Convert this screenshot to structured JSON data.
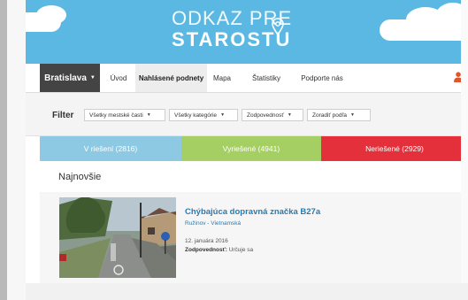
{
  "banner": {
    "logo_line1": "ODKAZ PRE",
    "logo_line2": "STAROSTU"
  },
  "nav": {
    "city": "Bratislava",
    "items": [
      {
        "label": "Úvod",
        "active": false
      },
      {
        "label": "Nahlásené podnety",
        "active": true
      },
      {
        "label": "Mapa",
        "active": false
      },
      {
        "label": "Štatistiky",
        "active": false
      },
      {
        "label": "Podporte nás",
        "active": false
      }
    ]
  },
  "filter": {
    "label": "Filter",
    "dropdowns": [
      "Všetky mestské časti",
      "Všetky kategórie",
      "Zodpovednosť",
      "Zoradiť podľa"
    ]
  },
  "status": {
    "in_progress": {
      "label": "V riešení (2816)",
      "color": "#8ec9e3"
    },
    "resolved": {
      "label": "Vyriešené (4941)",
      "color": "#a5cf62"
    },
    "unresolved": {
      "label": "Neriešené (2929)",
      "color": "#e4303a"
    }
  },
  "latest": {
    "title": "Najnovšie",
    "items": [
      {
        "title": "Chýbajúca dopravná značka B27a",
        "location": "Ružinov - Vietnamská",
        "date": "12. januára 2016",
        "responsibility_label": "Zodpovednosť:",
        "responsibility_value": "Určuje sa"
      }
    ]
  },
  "colors": {
    "banner": "#5bb8e2",
    "nav_city_bg": "#444444",
    "link": "#2a7ab0"
  }
}
